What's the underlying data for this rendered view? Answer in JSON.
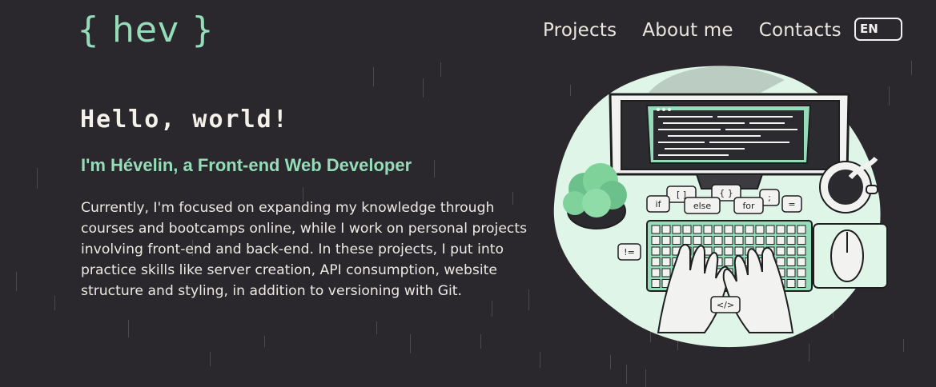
{
  "header": {
    "logo": "{ hev }",
    "nav": [
      "Projects",
      "About me",
      "Contacts"
    ],
    "lang": "EN"
  },
  "hero": {
    "greeting": "Hello, world!",
    "role": "I'm Hévelin, a Front-end Web Developer",
    "bio": "Currently, I'm focused on expanding my knowledge through courses and bootcamps online, while I work on personal projects involving front-end and back-end. In these projects, I put into practice skills like server creation, API consumption, website structure and styling, in addition to versioning with Git."
  },
  "illustration": {
    "bubbles": [
      "[ ]",
      "{ }",
      ";",
      "if",
      "else",
      "for",
      "=",
      "!=",
      "</>"
    ]
  },
  "colors": {
    "background": "#2a282d",
    "accent": "#95dcb9",
    "text": "#ece9e2"
  }
}
